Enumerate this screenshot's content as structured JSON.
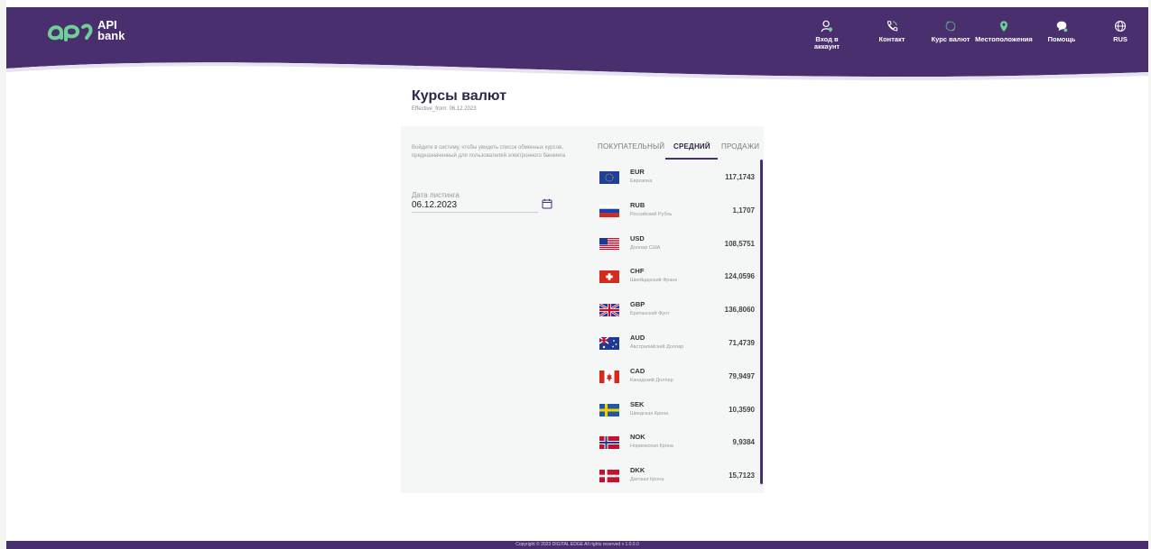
{
  "brand": {
    "logo_text_line1": "API",
    "logo_text_line2": "bank",
    "primary": "#4a2f6f",
    "accent": "#6fcf97"
  },
  "nav": [
    {
      "label_line1": "Вход в",
      "label_line2": "аккаунт",
      "icon": "user-icon"
    },
    {
      "label_line1": "Контакт",
      "label_line2": "",
      "icon": "phone-icon"
    },
    {
      "label_line1": "Курс валют",
      "label_line2": "",
      "icon": "currency-icon"
    },
    {
      "label_line1": "Местоположения",
      "label_line2": "",
      "icon": "location-pin-icon"
    },
    {
      "label_line1": "Помощь",
      "label_line2": "",
      "icon": "chat-help-icon"
    },
    {
      "label_line1": "RUS",
      "label_line2": "",
      "icon": "globe-icon"
    }
  ],
  "page": {
    "title": "Курсы валют",
    "effective": "Effective_from: 06.12.2023"
  },
  "sidebar": {
    "login_hint": "Войдите в систему, чтобы увидеть список обменных курсов, предназначенный для пользователей электронного банкинга",
    "date_label": "Дата листинга",
    "date_value": "06.12.2023"
  },
  "tabs": [
    {
      "label": "ПОКУПАТЕЛЬНЫЙ",
      "active": false
    },
    {
      "label": "СРЕДНИЙ",
      "active": true
    },
    {
      "label": "ПРОДАЖИ",
      "active": false
    }
  ],
  "rates": [
    {
      "code": "EUR",
      "name": "Еврозона",
      "value": "117,1743",
      "flag": "eu"
    },
    {
      "code": "RUB",
      "name": "Российский Рубль",
      "value": "1,1707",
      "flag": "ru"
    },
    {
      "code": "USD",
      "name": "Доллар США",
      "value": "108,5751",
      "flag": "us"
    },
    {
      "code": "CHF",
      "name": "Швейцарский Франк",
      "value": "124,0596",
      "flag": "ch"
    },
    {
      "code": "GBP",
      "name": "Британский Фунт",
      "value": "136,8060",
      "flag": "gb"
    },
    {
      "code": "AUD",
      "name": "Австралийский Доллар",
      "value": "71,4739",
      "flag": "au"
    },
    {
      "code": "CAD",
      "name": "Канадский Доллар",
      "value": "79,9497",
      "flag": "ca"
    },
    {
      "code": "SEK",
      "name": "Шведская Крона",
      "value": "10,3590",
      "flag": "se"
    },
    {
      "code": "NOK",
      "name": "Норвежская Крона",
      "value": "9,9384",
      "flag": "no"
    },
    {
      "code": "DKK",
      "name": "Датская Крона",
      "value": "15,7123",
      "flag": "dk"
    }
  ],
  "footer": {
    "text": "Copyright © 2023 DIGITAL EDGE All rights reserved v 1.0.0.0"
  }
}
